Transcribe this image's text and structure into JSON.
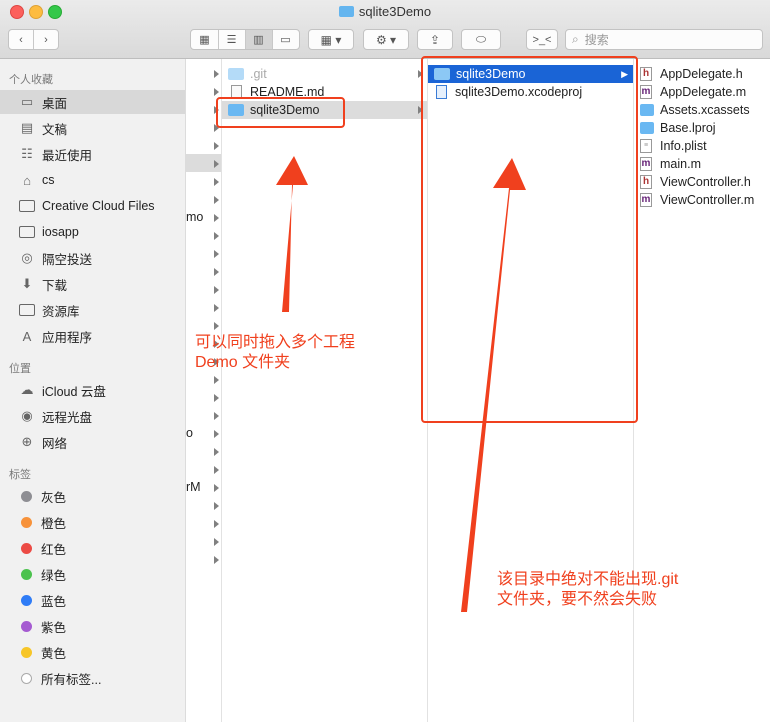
{
  "window": {
    "title": "sqlite3Demo"
  },
  "toolbar": {
    "search_placeholder": "搜索",
    "terminal_label": ">_<"
  },
  "sidebar": {
    "favorites_heading": "个人收藏",
    "favorites": [
      {
        "label": "桌面",
        "icon": "desktop-icon"
      },
      {
        "label": "文稿",
        "icon": "document-icon"
      },
      {
        "label": "最近使用",
        "icon": "recents-icon"
      },
      {
        "label": "cs",
        "icon": "home-icon"
      },
      {
        "label": "Creative Cloud Files",
        "icon": "folder-icon"
      },
      {
        "label": "iosapp",
        "icon": "folder-icon"
      },
      {
        "label": "隔空投送",
        "icon": "airdrop-icon"
      },
      {
        "label": "下载",
        "icon": "download-icon"
      },
      {
        "label": "资源库",
        "icon": "folder-icon"
      },
      {
        "label": "应用程序",
        "icon": "applications-icon"
      }
    ],
    "locations_heading": "位置",
    "locations": [
      {
        "label": "iCloud 云盘",
        "icon": "cloud-icon"
      },
      {
        "label": "远程光盘",
        "icon": "disc-icon"
      },
      {
        "label": "网络",
        "icon": "network-icon"
      }
    ],
    "tags_heading": "标签",
    "tags": [
      {
        "label": "灰色",
        "color": "#8e8e93"
      },
      {
        "label": "橙色",
        "color": "#f7923a"
      },
      {
        "label": "红色",
        "color": "#ec4b45"
      },
      {
        "label": "绿色",
        "color": "#4cc24e"
      },
      {
        "label": "蓝色",
        "color": "#2f7cf6"
      },
      {
        "label": "紫色",
        "color": "#a55bd1"
      },
      {
        "label": "黄色",
        "color": "#f7c628"
      },
      {
        "label": "所有标签...",
        "color": "#d0d0d0"
      }
    ]
  },
  "col1_partial": [
    "mo",
    "o",
    "rM"
  ],
  "col2": [
    {
      "name": ".git",
      "kind": "folder",
      "dimmed": true
    },
    {
      "name": "README.md",
      "kind": "doc"
    },
    {
      "name": "sqlite3Demo",
      "kind": "folder",
      "selected": true
    }
  ],
  "col3": [
    {
      "name": "sqlite3Demo",
      "kind": "folder",
      "selected": true
    },
    {
      "name": "sqlite3Demo.xcodeproj",
      "kind": "xcodeproj"
    }
  ],
  "col4": [
    {
      "name": "AppDelegate.h",
      "badge": "h"
    },
    {
      "name": "AppDelegate.m",
      "badge": "m"
    },
    {
      "name": "Assets.xcassets",
      "badge": "folder"
    },
    {
      "name": "Base.lproj",
      "badge": "folder"
    },
    {
      "name": "Info.plist",
      "badge": "plist"
    },
    {
      "name": "main.m",
      "badge": "m"
    },
    {
      "name": "ViewController.h",
      "badge": "h"
    },
    {
      "name": "ViewController.m",
      "badge": "m"
    }
  ],
  "annotations": {
    "drag_hint_line1": "可以同时拖入多个工程",
    "drag_hint_line2": "Demo 文件夹",
    "git_warning_line1": "该目录中绝对不能出现.git",
    "git_warning_line2": "文件夹，要不然会失败",
    "color": "#f0401e"
  }
}
